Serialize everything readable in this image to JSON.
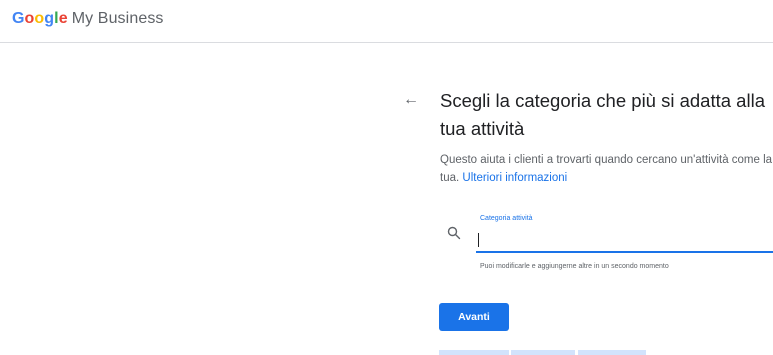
{
  "header": {
    "logo_letters": [
      "G",
      "o",
      "o",
      "g",
      "l",
      "e"
    ],
    "product": "My Business"
  },
  "main": {
    "title": "Scegli la categoria che più si adatta alla tua attività",
    "subtitle_text": "Questo aiuta i clienti a trovarti quando cercano un'attività come la tua.",
    "learn_more": "Ulteriori informazioni",
    "field_label": "Categoria attività",
    "field_value": "",
    "hint": "Puoi modificarle e aggiungerne altre in un secondo momento",
    "next_label": "Avanti"
  },
  "icons": {
    "back": "arrow-left-icon",
    "search": "search-icon"
  },
  "colors": {
    "accent": "#1a73e8",
    "text": "#202124",
    "muted": "#5f6368"
  }
}
